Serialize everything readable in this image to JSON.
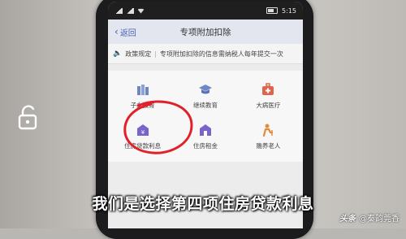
{
  "status": {
    "right_text": "5:15"
  },
  "nav": {
    "back_label": "返回",
    "title": "专项附加扣除"
  },
  "notice": {
    "label": "政策规定",
    "text": "专项附加扣除的信息需纳税人每年提交一次"
  },
  "tiles": [
    {
      "label": "子女教育",
      "icon": "children-education-icon",
      "color": "#6d86c7"
    },
    {
      "label": "继续教育",
      "icon": "graduation-cap-icon",
      "color": "#6d86c7"
    },
    {
      "label": "大病医疗",
      "icon": "medical-kit-icon",
      "color": "#e0644f"
    },
    {
      "label": "住房贷款利息",
      "icon": "house-loan-icon",
      "color": "#7a63c9"
    },
    {
      "label": "住房租金",
      "icon": "house-rent-icon",
      "color": "#7a63c9"
    },
    {
      "label": "赡养老人",
      "icon": "elderly-care-icon",
      "color": "#e08a3a"
    }
  ],
  "caption": "我们是选择第四项住房贷款利息",
  "watermark": {
    "brand": "头条",
    "author": "@秦韵莞香"
  },
  "colors": {
    "accent": "#4a62b8",
    "highlight_circle": "#e1202a"
  }
}
